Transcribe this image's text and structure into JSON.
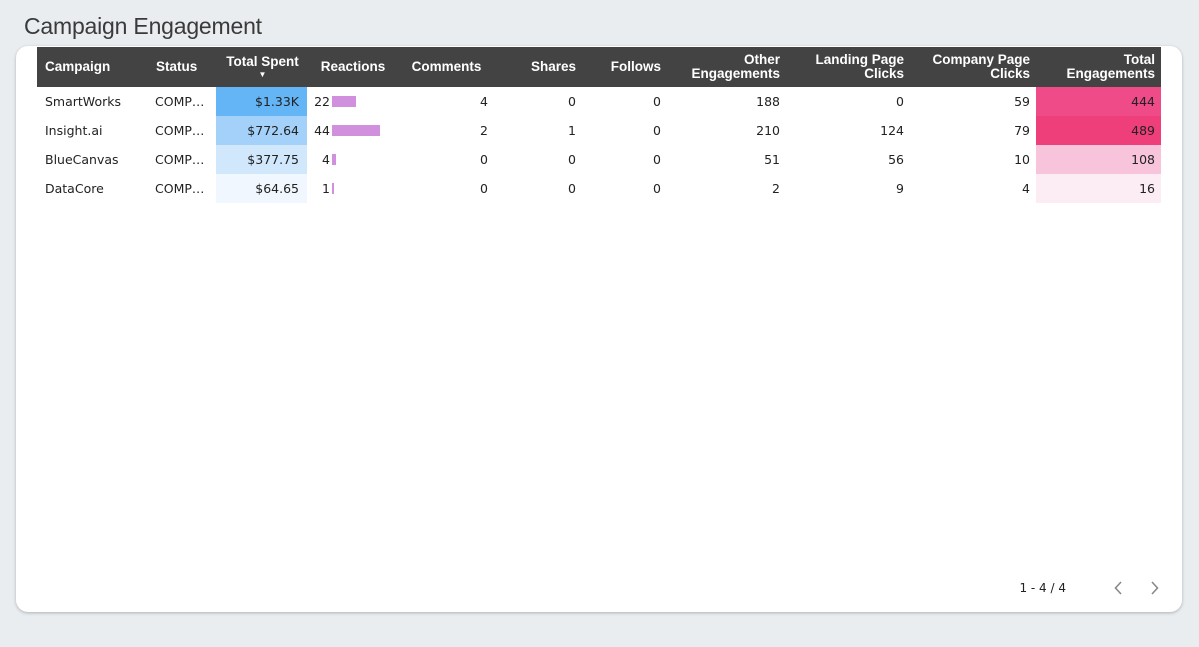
{
  "title": "Campaign Engagement",
  "table": {
    "headers": {
      "campaign": "Campaign",
      "status": "Status",
      "total_spent": "Total Spent",
      "reactions": "Reactions",
      "comments": "Comments",
      "shares": "Shares",
      "follows": "Follows",
      "other_engagements_1": "Other",
      "other_engagements_2": "Engagements",
      "landing_page_clicks_1": "Landing Page",
      "landing_page_clicks_2": "Clicks",
      "company_page_clicks_1": "Company Page",
      "company_page_clicks_2": "Clicks",
      "total_engagements_1": "Total",
      "total_engagements_2": "Engagements",
      "sort_indicator": "▼"
    },
    "rows": [
      {
        "campaign": "SmartWorks",
        "status": "COMP…",
        "total_spent": "$1.33K",
        "spent_value": 1330,
        "reactions": "22",
        "reactions_value": 22,
        "comments": "4",
        "shares": "0",
        "follows": "0",
        "other_engagements": "188",
        "landing_page_clicks": "0",
        "company_page_clicks": "59",
        "total_engagements": "444",
        "total_value": 444
      },
      {
        "campaign": "Insight.ai",
        "status": "COMP…",
        "total_spent": "$772.64",
        "spent_value": 772.64,
        "reactions": "44",
        "reactions_value": 44,
        "comments": "2",
        "shares": "1",
        "follows": "0",
        "other_engagements": "210",
        "landing_page_clicks": "124",
        "company_page_clicks": "79",
        "total_engagements": "489",
        "total_value": 489
      },
      {
        "campaign": "BlueCanvas",
        "status": "COMP…",
        "total_spent": "$377.75",
        "spent_value": 377.75,
        "reactions": "4",
        "reactions_value": 4,
        "comments": "0",
        "shares": "0",
        "follows": "0",
        "other_engagements": "51",
        "landing_page_clicks": "56",
        "company_page_clicks": "10",
        "total_engagements": "108",
        "total_value": 108
      },
      {
        "campaign": "DataCore",
        "status": "COMP…",
        "total_spent": "$64.65",
        "spent_value": 64.65,
        "reactions": "1",
        "reactions_value": 1,
        "comments": "0",
        "shares": "0",
        "follows": "0",
        "other_engagements": "2",
        "landing_page_clicks": "9",
        "company_page_clicks": "4",
        "total_engagements": "16",
        "total_value": 16
      }
    ]
  },
  "pagination": {
    "label": "1 - 4 / 4"
  },
  "colors": {
    "header_bg": "#434343",
    "spent_heat": [
      "#64b5f6",
      "#a3d1f9",
      "#d0e7fc",
      "#f0f7fe"
    ],
    "total_heat": [
      "#ee4b88",
      "#ef3f7a",
      "#f8c4dc",
      "#fcecf3"
    ],
    "reactions_bar": "#d190dd"
  },
  "icons": {
    "prev": "chevron-left-icon",
    "next": "chevron-right-icon"
  }
}
